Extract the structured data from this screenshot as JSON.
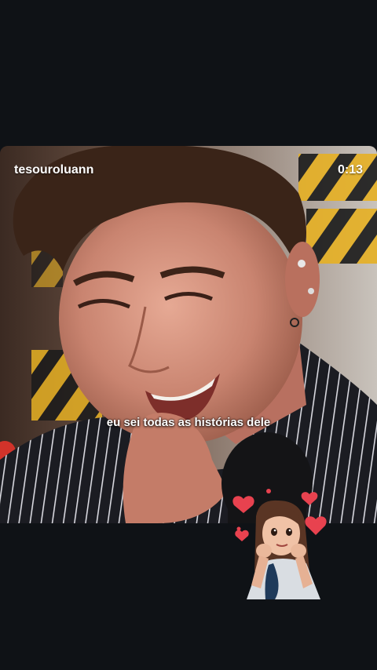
{
  "video": {
    "username": "tesouroluann",
    "timestamp": "0:13",
    "caption": "eu sei todas as histórias dele"
  },
  "sticker": {
    "icon": "girl-hearts-sticker-icon"
  },
  "colors": {
    "background": "#0f1216",
    "caption_text": "#ffffff",
    "heart": "#e8424f",
    "tape_yellow": "#e6b023"
  }
}
